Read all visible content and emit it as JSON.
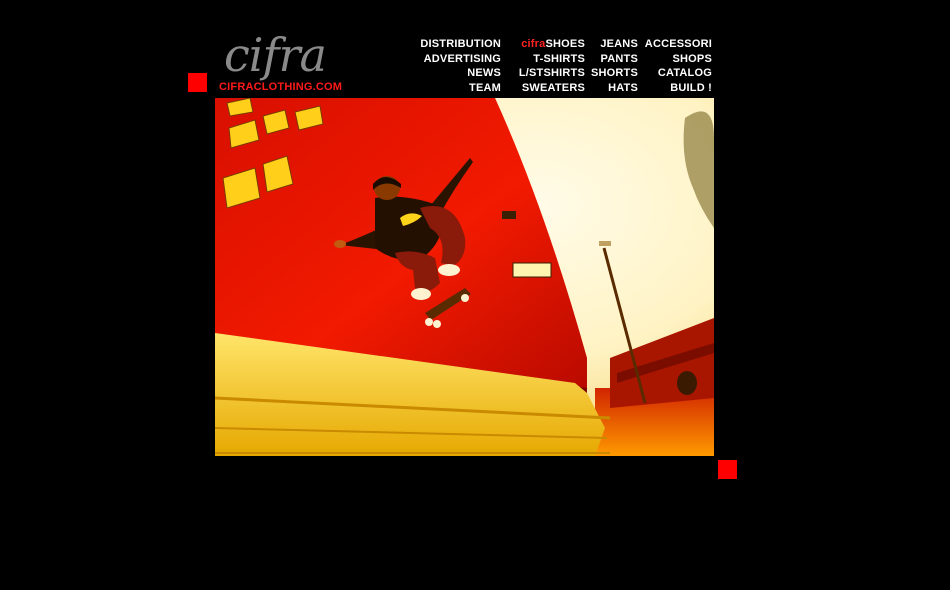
{
  "logo": {
    "wordmark": "cifra",
    "url_text": "CIFRACLOTHING.COM"
  },
  "nav": {
    "rows": [
      [
        {
          "name": "nav-distribution",
          "label": "DISTRIBUTION"
        },
        {
          "name": "nav-cifra-shoes",
          "brand": "cifra",
          "label": "SHOES"
        },
        {
          "name": "nav-jeans",
          "label": "JEANS"
        },
        {
          "name": "nav-accessori",
          "label": "ACCESSORI"
        }
      ],
      [
        {
          "name": "nav-advertising",
          "label": "ADVERTISING"
        },
        {
          "name": "nav-t-shirts",
          "label": "T-SHIRTS"
        },
        {
          "name": "nav-pants",
          "label": "PANTS"
        },
        {
          "name": "nav-shops",
          "label": "SHOPS"
        }
      ],
      [
        {
          "name": "nav-news",
          "label": "NEWS"
        },
        {
          "name": "nav-l-st-shirts",
          "label": "L/STSHIRTS"
        },
        {
          "name": "nav-shorts",
          "label": "SHORTS"
        },
        {
          "name": "nav-catalog",
          "label": "CATALOG"
        }
      ],
      [
        {
          "name": "nav-team",
          "label": "TEAM"
        },
        {
          "name": "nav-sweaters",
          "label": "SWEATERS"
        },
        {
          "name": "nav-hats",
          "label": "HATS"
        },
        {
          "name": "nav-build",
          "label": "BUILD !"
        }
      ]
    ]
  },
  "colors": {
    "background": "#000000",
    "accent_red": "#ff0000",
    "logo_gray": "#8a8a8a",
    "nav_text": "#ffffff"
  },
  "hero": {
    "alt": "skateboarder-wallride-photo"
  }
}
